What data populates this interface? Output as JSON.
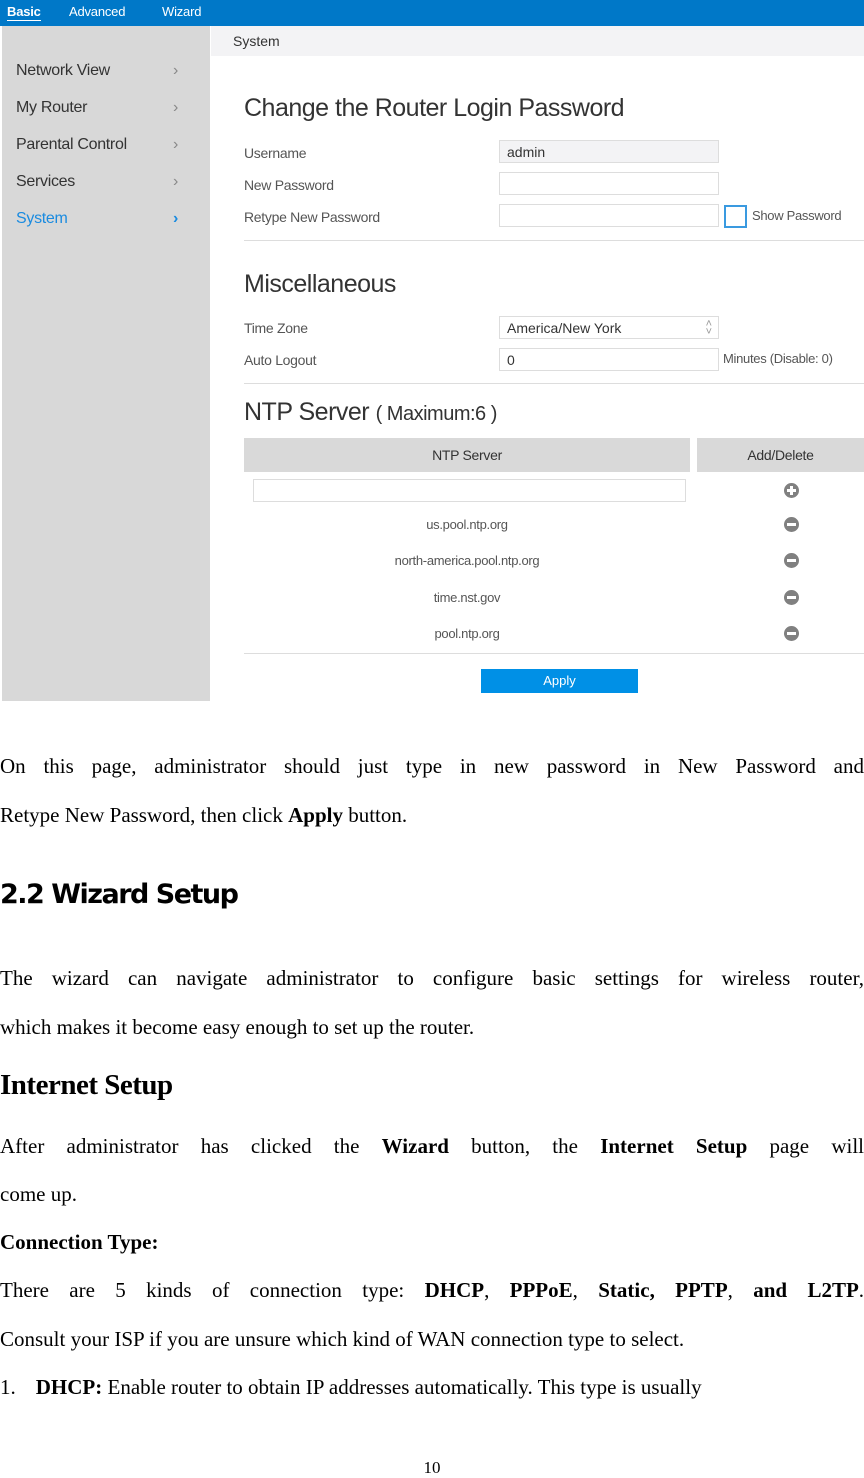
{
  "topbar": {
    "tabs": [
      {
        "label": "Basic",
        "active": true
      },
      {
        "label": "Advanced",
        "active": false
      },
      {
        "label": "Wizard",
        "active": false
      }
    ]
  },
  "breadcrumb": "System",
  "sidebar": {
    "items": [
      {
        "label": "Network View",
        "icon": "chevron-right-icon",
        "active": false
      },
      {
        "label": "My Router",
        "icon": "chevron-right-icon",
        "active": false
      },
      {
        "label": "Parental Control",
        "icon": "chevron-right-icon",
        "active": false
      },
      {
        "label": "Services",
        "icon": "chevron-right-icon",
        "active": false
      },
      {
        "label": "System",
        "icon": "chevron-right-icon",
        "active": true
      }
    ],
    "chevron": "›"
  },
  "password_section": {
    "title": "Change the Router Login Password",
    "username_label": "Username",
    "username_value": "admin",
    "new_password_label": "New Password",
    "new_password_value": "",
    "retype_label": "Retype New Password",
    "retype_value": "",
    "show_password_label": "Show Password",
    "show_password_checked": false
  },
  "misc_section": {
    "title": "Miscellaneous",
    "timezone_label": "Time Zone",
    "timezone_value": "America/New York",
    "auto_logout_label": "Auto Logout",
    "auto_logout_value": "0",
    "auto_logout_note": "Minutes (Disable: 0)"
  },
  "ntp_section": {
    "title": "NTP Server",
    "title_suffix": "( Maximum:6 )",
    "col_server": "NTP Server",
    "col_action": "Add/Delete",
    "new_server_value": "",
    "servers": [
      "us.pool.ntp.org",
      "north-america.pool.ntp.org",
      "time.nst.gov",
      "pool.ntp.org"
    ]
  },
  "apply_label": "Apply",
  "colors": {
    "topbar": "#0078c8",
    "accent": "#1a8be0",
    "apply_button": "#0090e6",
    "sidebar_bg": "#d8d8d8"
  },
  "doc": {
    "para1_line1": "On this page, administrator should just type in new password in New Password and",
    "para1_line2_pre": "Retype New Password, then click ",
    "para1_line2_bold": "Apply",
    "para1_line2_post": " button.",
    "section_heading": "2.2 Wizard Setup",
    "para2_line1": "The wizard can navigate administrator to configure basic settings for wireless router,",
    "para2_line2": "which makes it become easy enough to set up the router.",
    "subheading": "Internet Setup",
    "para3_line1_a": "After administrator has clicked the ",
    "para3_line1_b": "Wizard",
    "para3_line1_c": " button, the ",
    "para3_line1_d": "Internet Setup",
    "para3_line1_e": " page will",
    "para3_line2": "come up.",
    "conn_heading": "Connection Type:",
    "para4_line1_a": "There are 5 kinds of connection type: ",
    "para4_dhcp": "DHCP",
    "para4_sep1": ", ",
    "para4_pppoe": "PPPoE",
    "para4_sep2": ", ",
    "para4_static": "Static, PPTP",
    "para4_sep3": ", ",
    "para4_l2tp": "and L2TP",
    "para4_end": ".",
    "para4_line2": "Consult your ISP if you are unsure which kind of WAN connection type to select.",
    "list1_num": "1.",
    "list1_bold": "DHCP:",
    "list1_text": " Enable router to obtain IP addresses automatically. This type is usually",
    "page_number": "10"
  }
}
